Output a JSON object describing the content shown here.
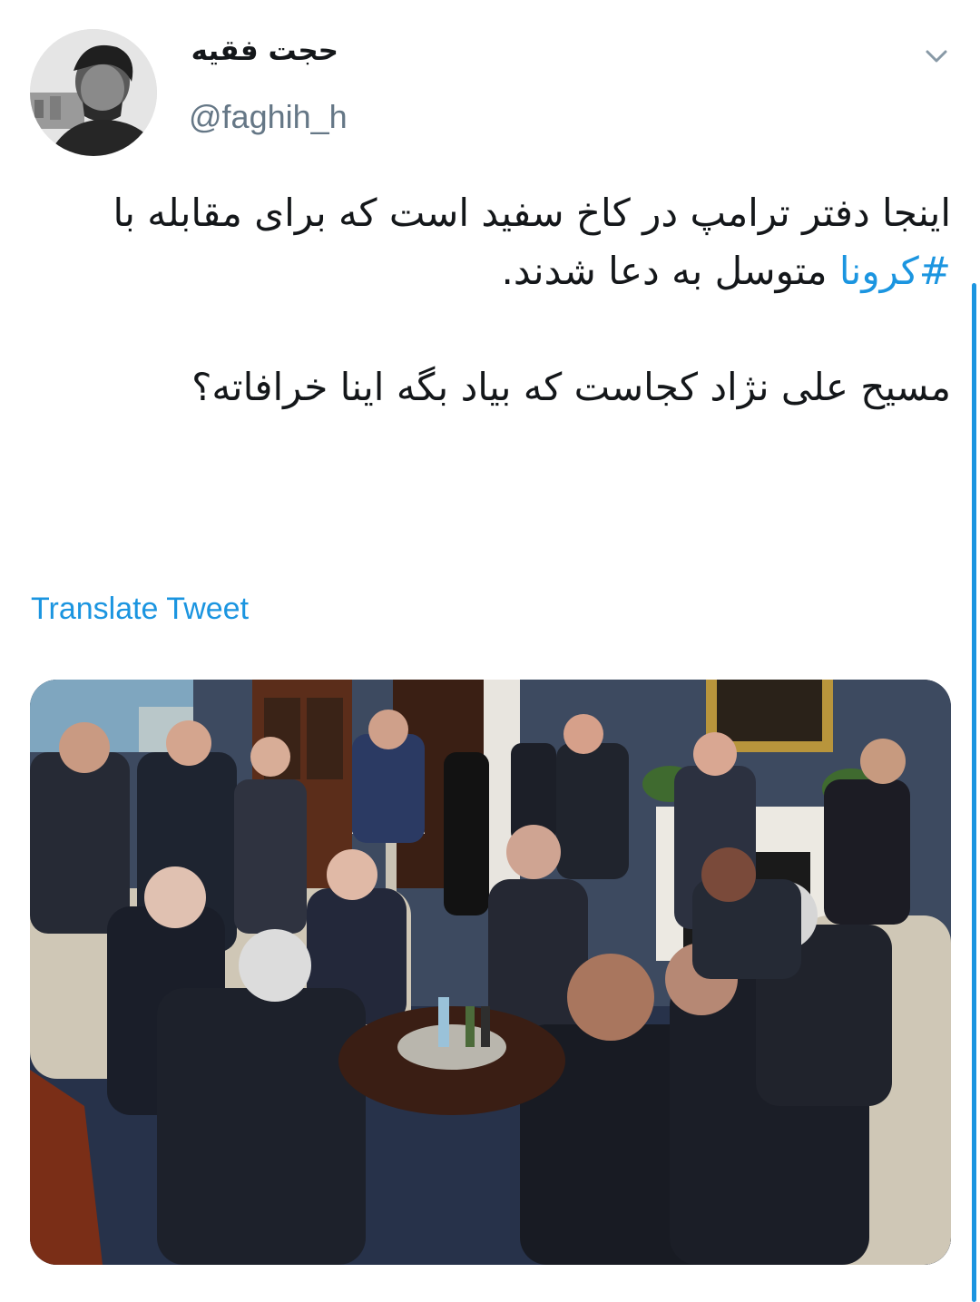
{
  "tweet": {
    "display_name": "حجت فقیه",
    "handle": "@faghih_h",
    "text_line1_before": "اینجا دفتر ترامپ در کاخ سفید است که برای مقابله با ",
    "hashtag": "#کرونا",
    "text_line1_after": " متوسل به دعا شدند.",
    "text_para2": "مسیح علی نژاد کجاست که بیاد بگه اینا خرافاته؟",
    "translate_label": "Translate Tweet"
  },
  "icons": {
    "caret": "chevron-down-icon"
  },
  "colors": {
    "link": "#1b95e0",
    "handle": "#657786",
    "text": "#14171a"
  }
}
